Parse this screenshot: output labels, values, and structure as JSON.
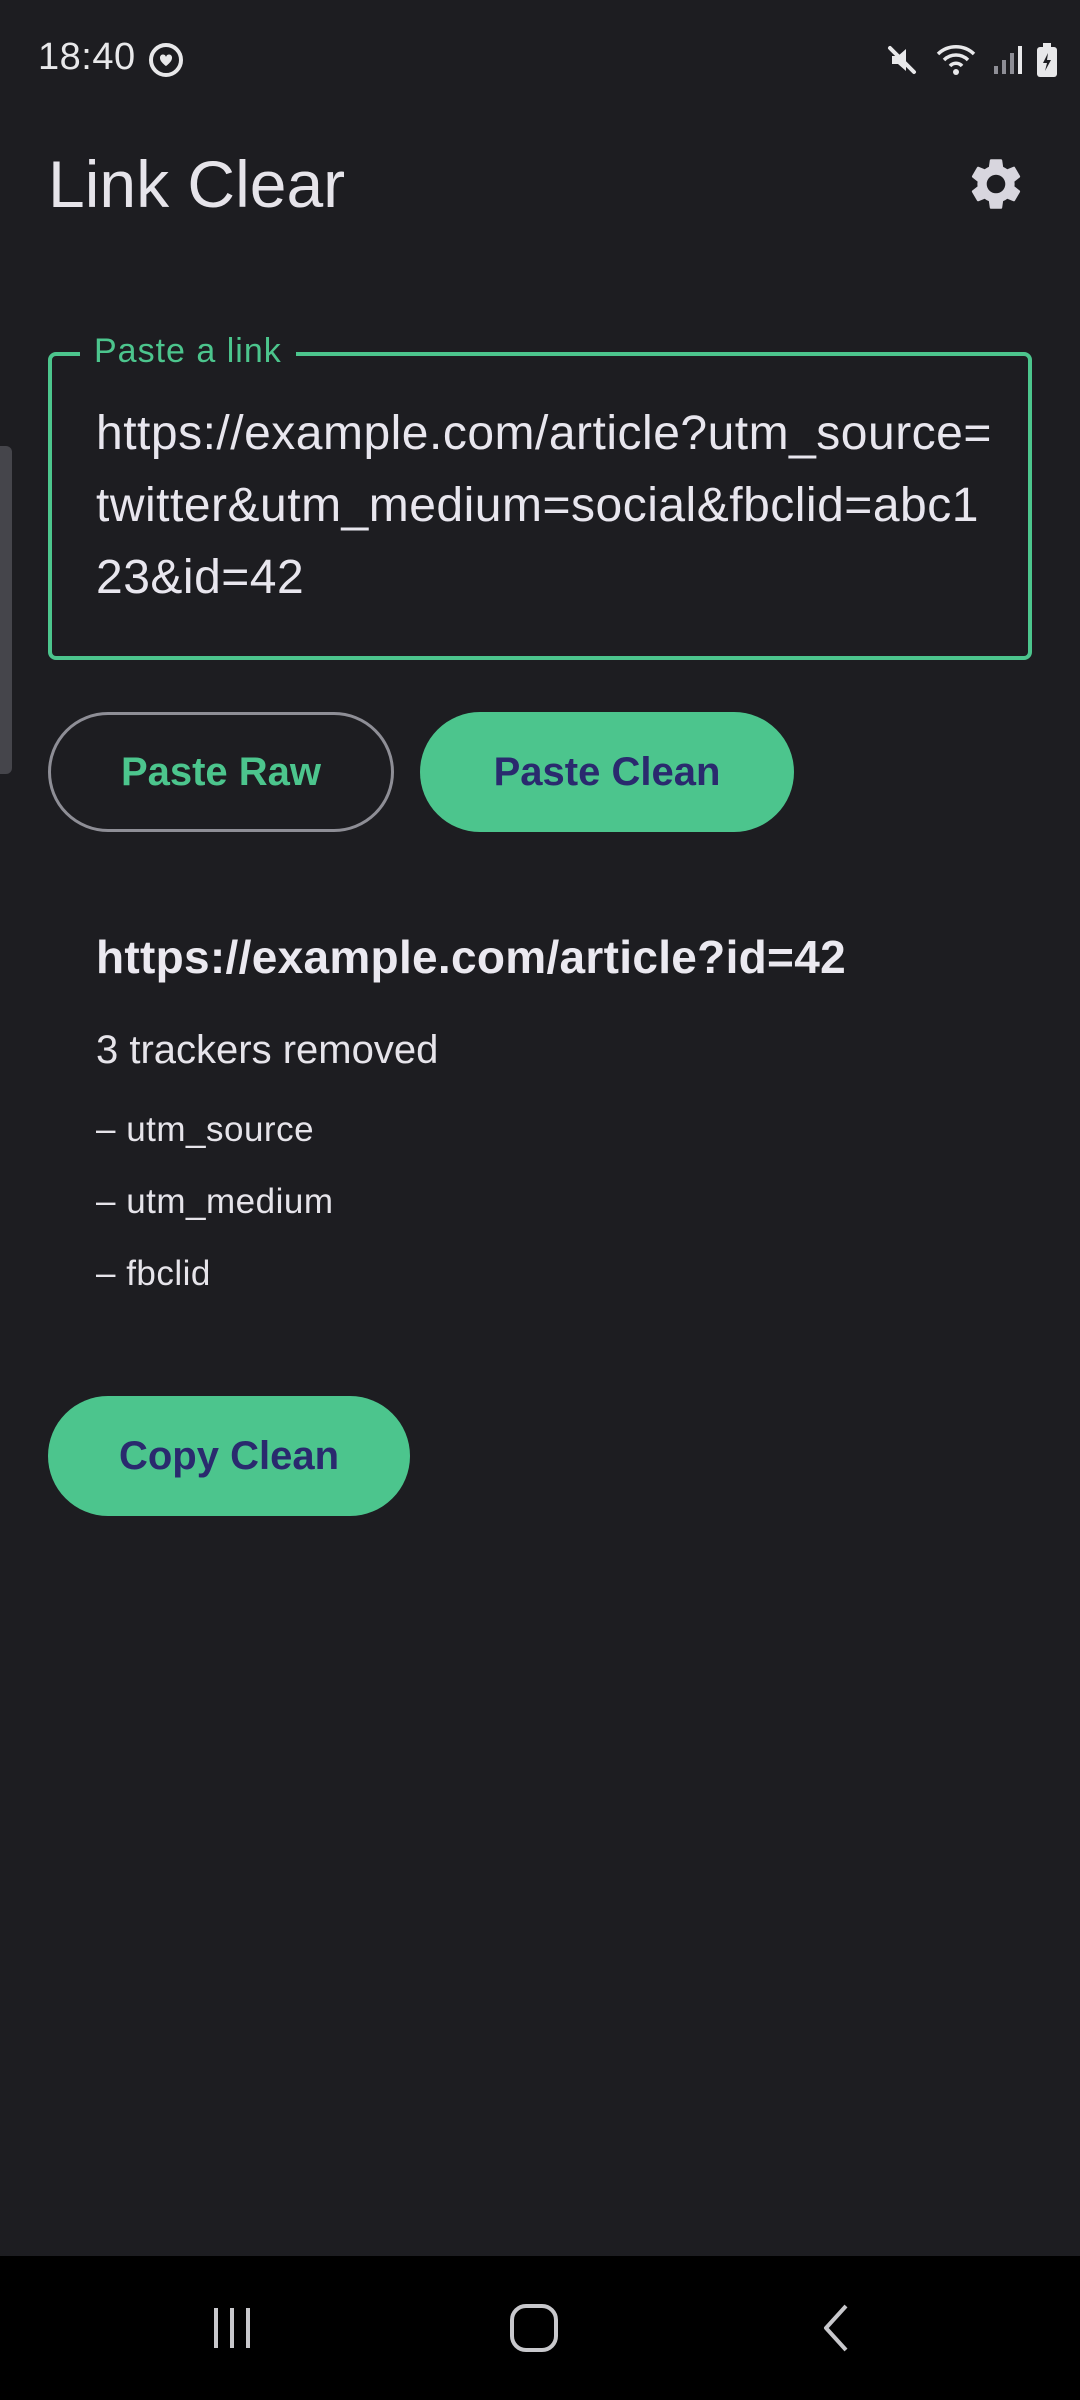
{
  "status_bar": {
    "time": "18:40",
    "icons": [
      "sync-heart-icon",
      "mute-icon",
      "wifi-icon",
      "signal-icon",
      "battery-icon"
    ]
  },
  "app_bar": {
    "title": "Link Clear",
    "settings_icon": "gear-icon"
  },
  "link_field": {
    "label": "Paste a link",
    "value": "https://example.com/article?utm_source=twitter&utm_medium=social&fbclid=abc123&id=42"
  },
  "actions": {
    "paste_raw": "Paste Raw",
    "paste_clean": "Paste Clean"
  },
  "result": {
    "clean_url": "https://example.com/article?id=42",
    "trackers_summary": "3 trackers removed",
    "removed": [
      "– utm_source",
      "– utm_medium",
      "– fbclid"
    ]
  },
  "copy_button": "Copy Clean",
  "nav_bar": {
    "icons": [
      "recent-apps-icon",
      "home-icon",
      "back-icon"
    ]
  },
  "colors": {
    "background": "#1d1d21",
    "accent": "#4cc58d",
    "button_text": "#2a2a6e"
  }
}
